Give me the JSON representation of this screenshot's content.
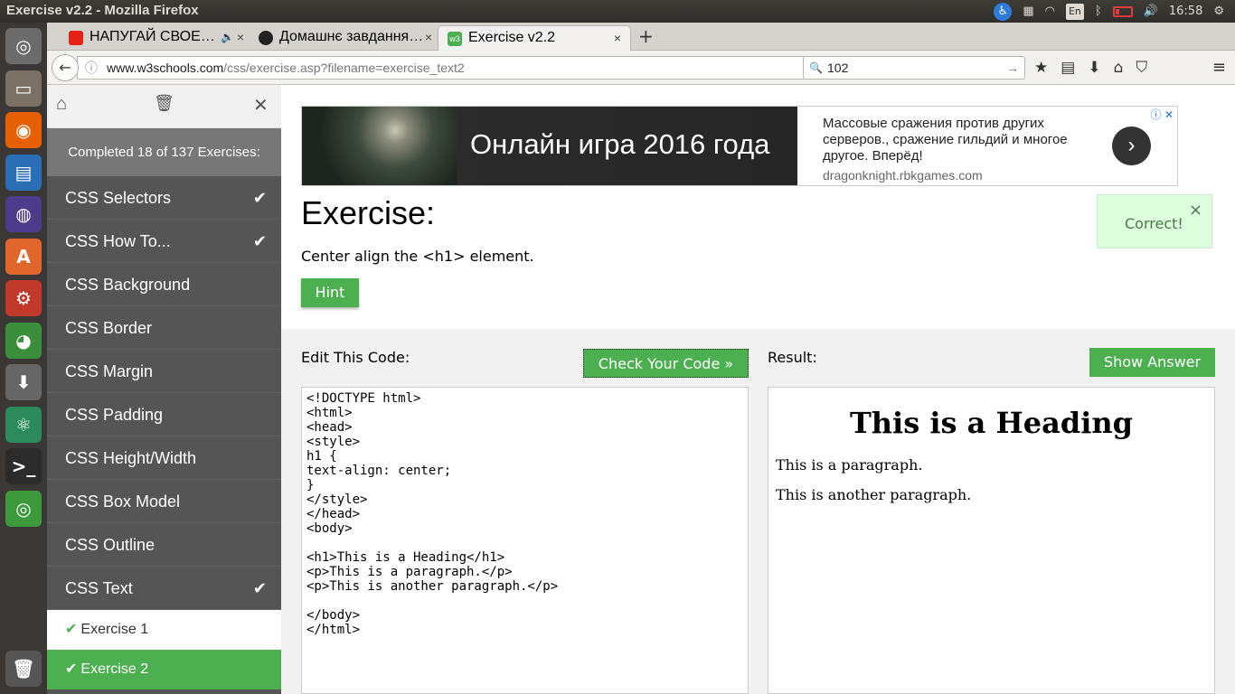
{
  "window": {
    "title": "Exercise v2.2 - Mozilla Firefox"
  },
  "tray": {
    "lang": "En",
    "time": "16:58",
    "accessibility": "♿",
    "volume": "🔊",
    "bluetooth": "ᛒ"
  },
  "tabs": [
    {
      "label": "НАПУГАЙ СВОЕ…",
      "fav_color": "#e62117",
      "audio": "🔈"
    },
    {
      "label": "Домашнє завдання…",
      "fav_color": "#222"
    },
    {
      "label": "Exercise v2.2",
      "fav_color": "#4caf50",
      "fav_text": "w3"
    }
  ],
  "newtab": "+",
  "close": "×",
  "nav": {
    "back": "←",
    "info": "ⓘ",
    "url_host": "www.w3schools.com",
    "url_path": "/css/exercise.asp?filename=exercise_text2",
    "reload": "↻",
    "search_icon": "🔍",
    "search_value": "102",
    "search_go": "→",
    "tools": [
      "★",
      "▤",
      "⬇",
      "⌂",
      "⛉"
    ],
    "menu": "≡"
  },
  "sidebar": {
    "home": "⌂",
    "trash": "🗑",
    "close": "✕",
    "progress": "Completed 18 of 137 Exercises:",
    "check": "✔",
    "items": [
      {
        "label": "CSS Selectors",
        "done": "✔"
      },
      {
        "label": "CSS How To...",
        "done": "✔"
      },
      {
        "label": "CSS Background",
        "done": ""
      },
      {
        "label": "CSS Border",
        "done": ""
      },
      {
        "label": "CSS Margin",
        "done": ""
      },
      {
        "label": "CSS Padding",
        "done": ""
      },
      {
        "label": "CSS Height/Width",
        "done": ""
      },
      {
        "label": "CSS Box Model",
        "done": ""
      },
      {
        "label": "CSS Outline",
        "done": ""
      },
      {
        "label": "CSS Text",
        "done": "✔"
      }
    ],
    "exercises": [
      {
        "label": "Exercise 1"
      },
      {
        "label": "Exercise 2"
      }
    ]
  },
  "ad": {
    "headline": "Онлайн игра 2016 года",
    "text": "Массовые сражения против других серверов., сражение гильдий и многое другое. Вперёд!",
    "domain": "dragonknight.rbkgames.com",
    "arrow": "›",
    "adchoices": "ⓘ ✕"
  },
  "exercise": {
    "title": "Exercise:",
    "instruction": "Center align the <h1> element.",
    "hint": "Hint",
    "correct": "Correct!",
    "correct_close": "×"
  },
  "editor": {
    "label": "Edit This Code:",
    "check_button": "Check Your Code »",
    "code": "<!DOCTYPE html>\n<html>\n<head>\n<style>\nh1 {\ntext-align: center;\n}\n</style>\n</head>\n<body>\n\n<h1>This is a Heading</h1>\n<p>This is a paragraph.</p>\n<p>This is another paragraph.</p>\n\n</body>\n</html>"
  },
  "result": {
    "label": "Result:",
    "show_answer": "Show Answer",
    "heading": "This is a Heading",
    "p1": "This is a paragraph.",
    "p2": "This is another paragraph."
  },
  "launcher": [
    {
      "name": "ubuntu-dash-icon",
      "color": "#6b6b6b",
      "glyph": "◎"
    },
    {
      "name": "files-icon",
      "color": "#7a7066",
      "glyph": "▭"
    },
    {
      "name": "firefox-icon",
      "color": "#e66000",
      "glyph": "◉"
    },
    {
      "name": "document-viewer-icon",
      "color": "#2a6fb5",
      "glyph": "▤"
    },
    {
      "name": "eclipse-icon",
      "color": "#4b3c8c",
      "glyph": "◍"
    },
    {
      "name": "software-center-icon",
      "color": "#e0662c",
      "glyph": "A"
    },
    {
      "name": "system-settings-icon",
      "color": "#c0392b",
      "glyph": "⚙"
    },
    {
      "name": "chrome-icon",
      "color": "#3b8e3b",
      "glyph": "◕"
    },
    {
      "name": "installer-icon",
      "color": "#666",
      "glyph": "⬇"
    },
    {
      "name": "atom-icon",
      "color": "#2d8a5d",
      "glyph": "⚛"
    },
    {
      "name": "terminal-icon",
      "color": "#2b2b2b",
      "glyph": ">_"
    },
    {
      "name": "network-icon",
      "color": "#3c9a3c",
      "glyph": "◎"
    },
    {
      "name": "trash-icon",
      "color": "#555",
      "glyph": "🗑"
    }
  ]
}
